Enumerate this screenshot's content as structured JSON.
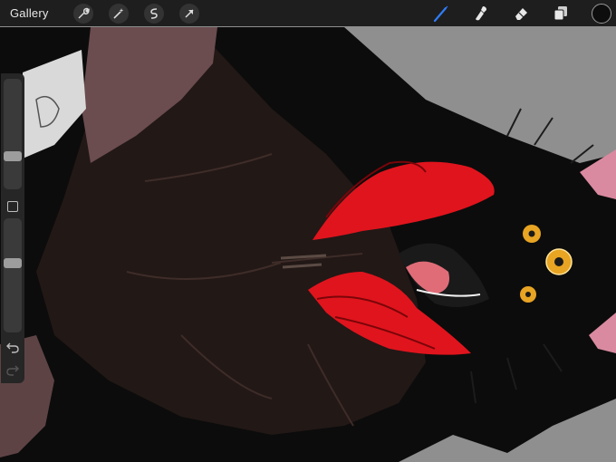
{
  "toolbar": {
    "gallery_label": "Gallery",
    "left_icons": [
      "wrench-icon",
      "magic-wand-icon",
      "selection-icon",
      "transform-arrow-icon"
    ],
    "right_icons": [
      "brush-icon",
      "smudge-icon",
      "eraser-icon",
      "layers-icon"
    ],
    "active_tool": "brush-icon",
    "current_color": "#0d0d0d",
    "accent_color": "#2f7cf6"
  },
  "sidebar": {
    "brush_size_level": 0.28,
    "opacity_level": 0.62,
    "icons": [
      "modify-square-icon",
      "undo-icon",
      "redo-icon"
    ]
  },
  "canvas": {
    "background_color": "#8f8f8f",
    "subject_colors": [
      "#0c0c0c",
      "#221816",
      "#6b4c4f",
      "#e0141d",
      "#e8a423",
      "#e06c78"
    ]
  }
}
